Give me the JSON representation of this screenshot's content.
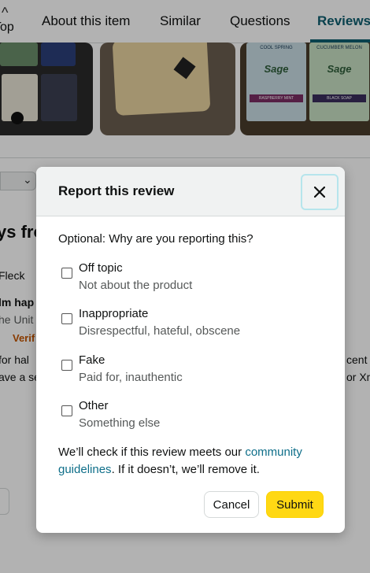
{
  "nav": {
    "top_label": "Top",
    "tabs": [
      {
        "label": "About this item"
      },
      {
        "label": "Similar"
      },
      {
        "label": "Questions"
      },
      {
        "label": "Reviews"
      }
    ]
  },
  "photos": {
    "box_label_1": "Sage",
    "box_label_2": "Sage",
    "box_top_1": "COOL SPRING",
    "box_top_2": "CUCUMBER MELON",
    "box_bottom_1": "RASPBERRY MINT",
    "box_bottom_2": "BLACK SOAP"
  },
  "background": {
    "heading_fragment": "ys fro",
    "reviewer_fragment": "Fleck",
    "review_title_fragment": "lm hap",
    "country_fragment": "he Unit",
    "verified_fragment": "Verif",
    "line1_fragment": "for hal",
    "line2_fragment": "ave a se",
    "right1_fragment": "cent",
    "right2_fragment": "or Xm"
  },
  "modal": {
    "title": "Report this review",
    "close_icon": "close-icon",
    "question": "Optional: Why are you reporting this?",
    "options": [
      {
        "title": "Off topic",
        "subtitle": "Not about the product"
      },
      {
        "title": "Inappropriate",
        "subtitle": "Disrespectful, hateful, obscene"
      },
      {
        "title": "Fake",
        "subtitle": "Paid for, inauthentic"
      },
      {
        "title": "Other",
        "subtitle": "Something else"
      }
    ],
    "notice_before": "We’ll check if this review meets our ",
    "notice_link": "community guidelines",
    "notice_after": ". If it doesn’t, we’ll remove it.",
    "cancel_label": "Cancel",
    "submit_label": "Submit"
  },
  "colors": {
    "accent_teal": "#0e5e6f",
    "link": "#0e6e89",
    "submit_yellow": "#ffd814",
    "verified_orange": "#c45500"
  }
}
